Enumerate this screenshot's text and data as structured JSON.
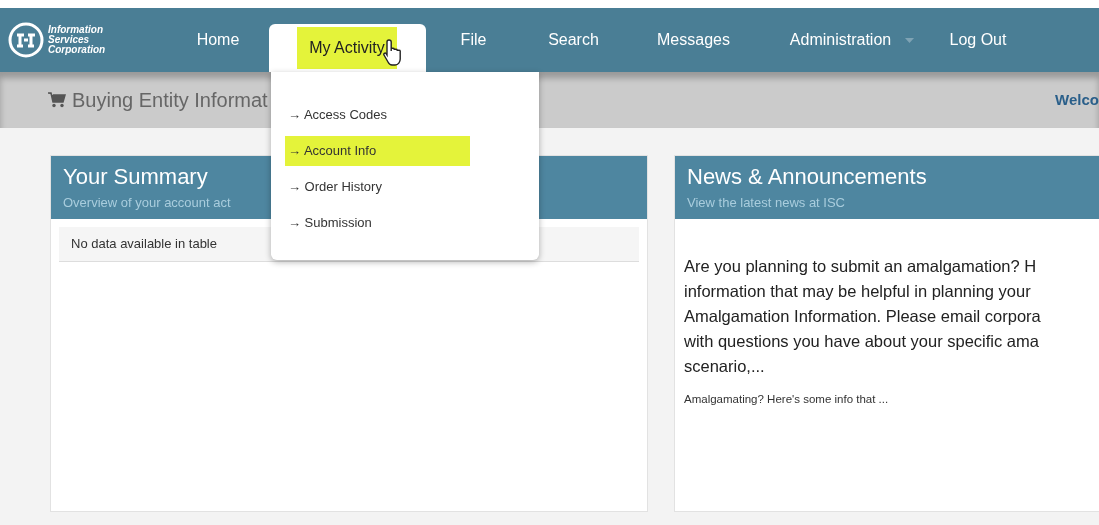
{
  "brand": {
    "lines": [
      "Information",
      "Services",
      "Corporation"
    ]
  },
  "nav": [
    {
      "label": "Home",
      "selected": false,
      "caret": false
    },
    {
      "label": "My Activity",
      "selected": true,
      "caret": false
    },
    {
      "label": "File",
      "selected": false,
      "caret": false
    },
    {
      "label": "Search",
      "selected": false,
      "caret": false
    },
    {
      "label": "Messages",
      "selected": false,
      "caret": false
    },
    {
      "label": "Administration",
      "selected": false,
      "caret": true
    },
    {
      "label": "Log Out",
      "selected": false,
      "caret": false
    }
  ],
  "dropdown": [
    {
      "label": "→ Access Codes",
      "highlighted": false
    },
    {
      "label": "→ Account Info",
      "highlighted": true
    },
    {
      "label": "→ Order History",
      "highlighted": false
    },
    {
      "label": "→ Submission",
      "highlighted": false
    }
  ],
  "page_header": {
    "title": "Buying Entity Informat",
    "welcome": "Welco"
  },
  "summary": {
    "title": "Your Summary",
    "subtitle": "Overview of your account act",
    "empty": "No data available in table"
  },
  "news": {
    "title": "News & Announcements",
    "subtitle": "View the latest news at ISC",
    "body_lines": [
      "Are you planning to submit an amalgamation? H",
      "information that may be helpful in planning your",
      "Amalgamation Information. Please email corpora",
      "with questions you have about your specific ama",
      "scenario,..."
    ],
    "link": "Amalgamating? Here's some info that ..."
  }
}
